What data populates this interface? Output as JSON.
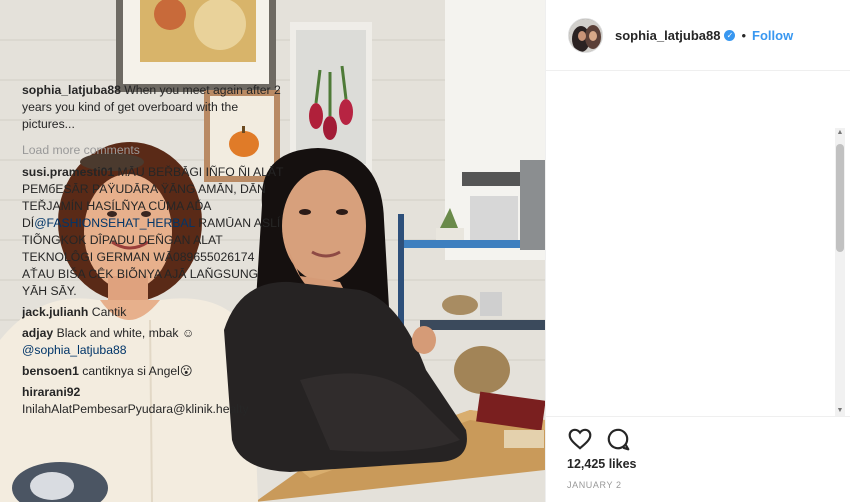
{
  "post": {
    "username": "sophia_latjuba88",
    "follow_label": "Follow",
    "dot": "•",
    "verified_mark": "✓"
  },
  "caption": {
    "username": "sophia_latjuba88",
    "text": "When you meet again after 2 years you kind of get overboard with the pictures..."
  },
  "load_more_label": "Load more comments",
  "comments": [
    {
      "username": "susi.pramesti01",
      "text_before": "MĀU BEŘBĀGI IÑFO ÑI ALĀT PEMбESĀR PAŸUDĀRA ŸĀNG AMĀN, DĀN TEŘJAMÍN HASÍLÑYA CŪMA AĎA DÍ",
      "mention": "@FASHIONSEHAT_HERBAL",
      "text_after": "RAMŪAN ASLÍ TIÕNGKOK DÎPADU DEÑGAN ALAT TEKNOLÔGI GERMAN WĀ089655026174 AŤAU BIŠA CÊK BIÕNYA AJĀ LAÑGSUNG YĀH SĀY."
    },
    {
      "username": "jack.julianh",
      "text": "Cantik"
    },
    {
      "username": "adjay",
      "text": "Black and white, mbak ☺",
      "mention": "@sophia_latjuba88"
    },
    {
      "username": "bensoen1",
      "text": "cantiknya si Angel😮"
    },
    {
      "username": "hirarani92",
      "text": "InilahAlatPembesarPyudara@klinik.healty bagus"
    }
  ],
  "actions": {
    "likes": "12,425 likes",
    "date": "January 2"
  },
  "icons": {
    "like": "heart-icon",
    "comment": "comment-bubble-icon",
    "verified": "verified-badge-icon"
  },
  "colors": {
    "accent": "#3897f0",
    "text": "#262626",
    "muted": "#999999",
    "mention": "#003569"
  }
}
